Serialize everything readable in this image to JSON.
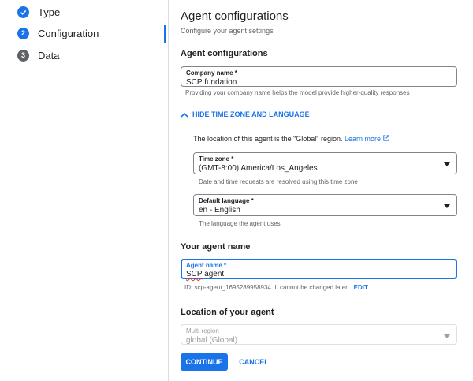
{
  "steps": [
    {
      "label": "Type",
      "state": "done"
    },
    {
      "label": "Configuration",
      "number": "2",
      "state": "active"
    },
    {
      "label": "Data",
      "number": "3",
      "state": "pending"
    }
  ],
  "page": {
    "title": "Agent configurations",
    "subtitle": "Configure your agent settings"
  },
  "agent_config": {
    "heading": "Agent configurations",
    "company_label": "Company name *",
    "company_value": "SCP fundation",
    "company_hint": "Providing your company name helps the model provide higher-quality responses",
    "toggle_label": "HIDE TIME ZONE AND LANGUAGE",
    "location_text": "The location of this agent is the \"Global\" region.",
    "learn_more": "Learn more",
    "timezone_label": "Time zone *",
    "timezone_value": "(GMT-8:00) America/Los_Angeles",
    "timezone_hint": "Date and time requests are resolved using this time zone",
    "language_label": "Default language *",
    "language_value": "en - English",
    "language_hint": "The language the agent uses"
  },
  "agent_name": {
    "heading": "Your agent name",
    "label": "Agent name *",
    "value_part1": "SCP",
    "value_part2": " agent",
    "id_text": "ID: scp-agent_1695289958934. It cannot be changed later.",
    "edit_label": "EDIT"
  },
  "location": {
    "heading": "Location of your agent",
    "label": "Multi-region",
    "value": "global (Global)"
  },
  "actions": {
    "continue": "CONTINUE",
    "cancel": "CANCEL"
  },
  "colors": {
    "accent": "#1a73e8",
    "pending": "#5f6368"
  }
}
